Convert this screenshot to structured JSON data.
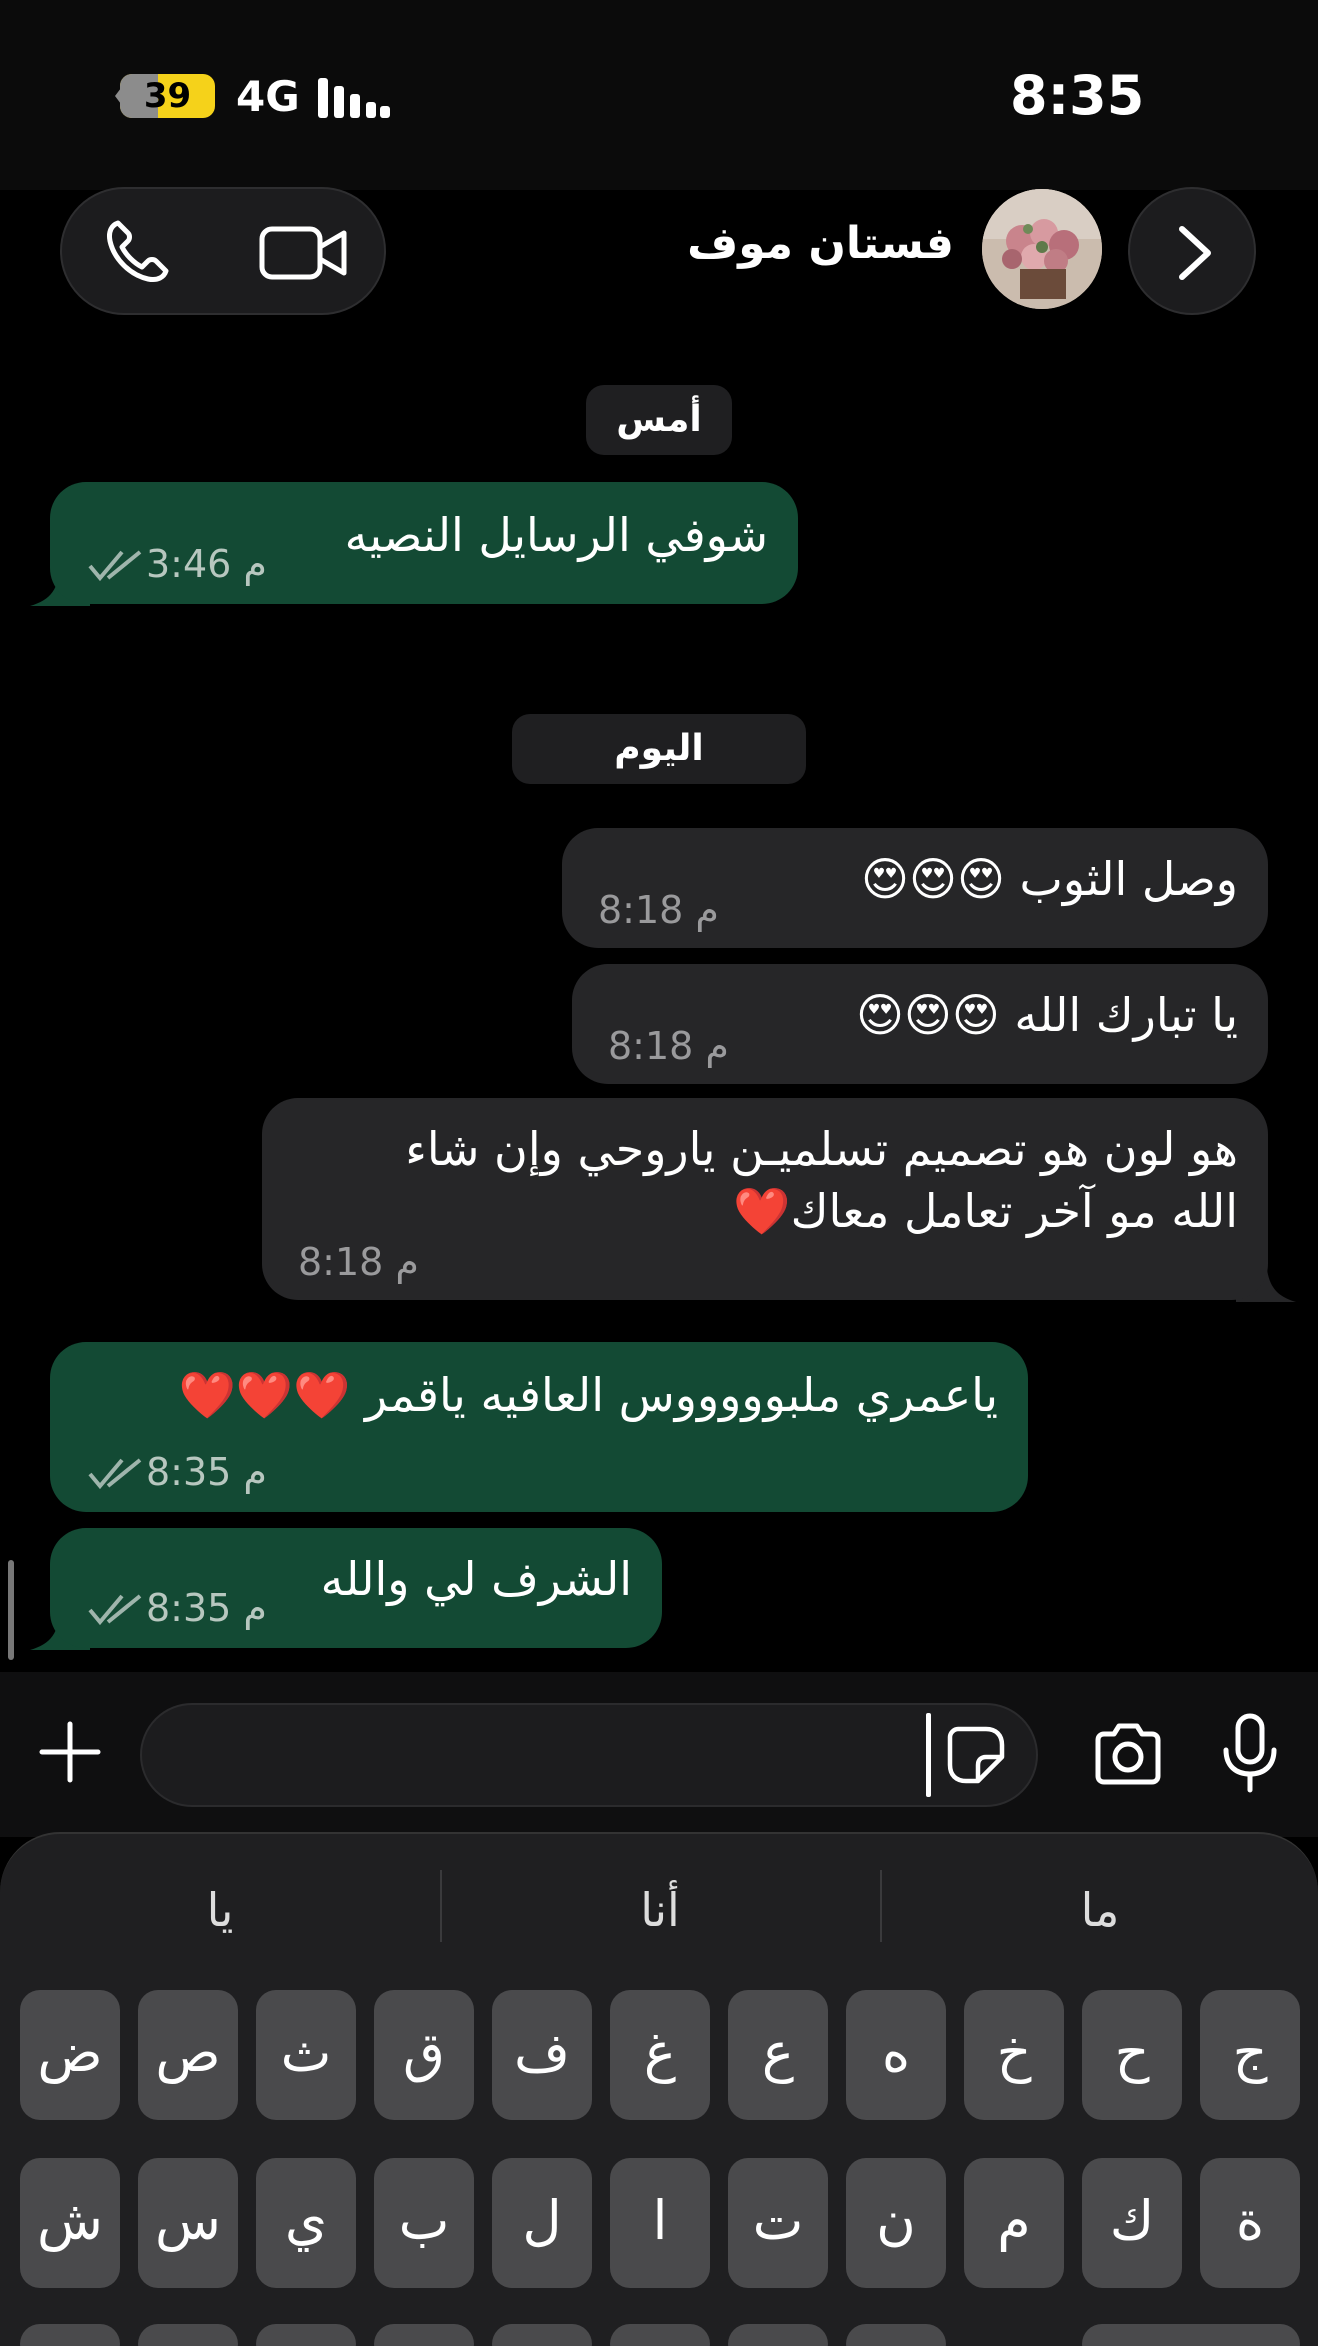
{
  "status_bar": {
    "time": "8:35",
    "battery": "39",
    "network": "4G"
  },
  "header": {
    "contact_name": "فستان موف"
  },
  "chat": {
    "dates": [
      "أمس",
      "اليوم"
    ],
    "messages": [
      {
        "text": "شوفي الرسايل النصيه",
        "time": "3:46 م",
        "direction": "outgoing"
      },
      {
        "text": "وصل الثوب 😍😍😍",
        "time": "8:18 م",
        "direction": "incoming"
      },
      {
        "text": "يا تبارك الله 😍😍😍",
        "time": "8:18 م",
        "direction": "incoming"
      },
      {
        "text": "هو لون هو تصميم تسلميـن ياروحي وإن شاء الله مو آخر تعامل معاك❤️",
        "time": "8:18 م",
        "direction": "incoming"
      },
      {
        "text": "ياعمري ملبوووووس العافيه ياقمر ❤️❤️❤️",
        "time": "8:35 م",
        "direction": "outgoing"
      },
      {
        "text": "الشرف لي والله",
        "time": "8:35 م",
        "direction": "outgoing"
      }
    ]
  },
  "input": {
    "placeholder": ""
  },
  "keyboard": {
    "suggestions": [
      "ما",
      "أنا",
      "يا"
    ],
    "row1": [
      "ض",
      "ص",
      "ث",
      "ق",
      "ف",
      "غ",
      "ع",
      "ه",
      "خ",
      "ح",
      "ج"
    ],
    "row2": [
      "ش",
      "س",
      "ي",
      "ب",
      "ل",
      "ا",
      "ت",
      "ن",
      "م",
      "ك",
      "ة"
    ]
  },
  "colors": {
    "outgoing_bubble": "#134a34",
    "incoming_bubble": "#262628",
    "background": "#000000",
    "battery": "#f5d21a"
  }
}
